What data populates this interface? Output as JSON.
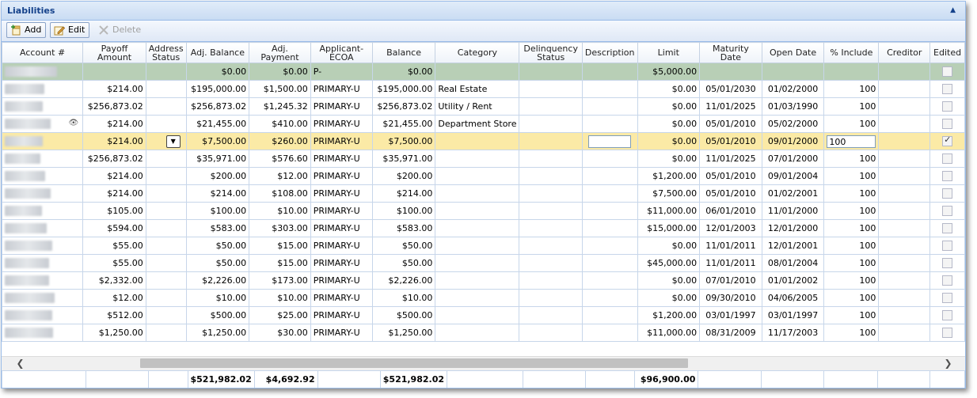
{
  "panel": {
    "title": "Liabilities"
  },
  "toolbar": {
    "add_label": "Add",
    "edit_label": "Edit",
    "delete_label": "Delete"
  },
  "columns": [
    "Account #",
    "Payoff Amount",
    "Address Status",
    "Adj. Balance",
    "Adj. Payment",
    "Applicant-ECOA",
    "Balance",
    "Category",
    "Delinquency Status",
    "Description",
    "Limit",
    "Maturity Date",
    "Open Date",
    "% Include",
    "Creditor",
    "Edited"
  ],
  "summary_row": {
    "adj_balance": "$0.00",
    "adj_payment": "$0.00",
    "applicant": "P-",
    "balance": "$0.00",
    "limit": "$5,000.00"
  },
  "rows": [
    {
      "payoff": "$214.00",
      "adj_balance": "$195,000.00",
      "adj_payment": "$1,500.00",
      "applicant": "PRIMARY-U",
      "balance": "$195,000.00",
      "category": "Real Estate",
      "limit": "$0.00",
      "maturity": "05/01/2030",
      "open": "01/02/2000",
      "include": "100"
    },
    {
      "payoff": "$256,873.02",
      "adj_balance": "$256,873.02",
      "adj_payment": "$1,245.32",
      "applicant": "PRIMARY-U",
      "balance": "$256,873.02",
      "category": "Utility / Rent",
      "limit": "$0.00",
      "maturity": "11/01/2025",
      "open": "01/03/1990",
      "include": "100"
    },
    {
      "payoff": "$214.00",
      "adj_balance": "$21,455.00",
      "adj_payment": "$410.00",
      "applicant": "PRIMARY-U",
      "balance": "$21,455.00",
      "category": "Department Store",
      "limit": "$0.00",
      "maturity": "05/01/2010",
      "open": "05/02/2000",
      "include": "100"
    },
    {
      "payoff": "$214.00",
      "adj_balance": "$7,500.00",
      "adj_payment": "$260.00",
      "applicant": "PRIMARY-U",
      "balance": "$7,500.00",
      "category": "",
      "limit": "$0.00",
      "maturity": "05/01/2010",
      "open": "09/01/2000",
      "include": "100"
    },
    {
      "payoff": "$256,873.02",
      "adj_balance": "$35,971.00",
      "adj_payment": "$576.60",
      "applicant": "PRIMARY-U",
      "balance": "$35,971.00",
      "category": "",
      "limit": "$0.00",
      "maturity": "11/01/2025",
      "open": "07/01/2000",
      "include": "100"
    },
    {
      "payoff": "$214.00",
      "adj_balance": "$200.00",
      "adj_payment": "$12.00",
      "applicant": "PRIMARY-U",
      "balance": "$200.00",
      "category": "",
      "limit": "$1,200.00",
      "maturity": "05/01/2010",
      "open": "09/01/2004",
      "include": "100"
    },
    {
      "payoff": "$214.00",
      "adj_balance": "$214.00",
      "adj_payment": "$108.00",
      "applicant": "PRIMARY-U",
      "balance": "$214.00",
      "category": "",
      "limit": "$7,500.00",
      "maturity": "05/01/2010",
      "open": "01/02/2001",
      "include": "100"
    },
    {
      "payoff": "$105.00",
      "adj_balance": "$100.00",
      "adj_payment": "$10.00",
      "applicant": "PRIMARY-U",
      "balance": "$100.00",
      "category": "",
      "limit": "$11,000.00",
      "maturity": "06/01/2010",
      "open": "11/01/2000",
      "include": "100"
    },
    {
      "payoff": "$594.00",
      "adj_balance": "$583.00",
      "adj_payment": "$303.00",
      "applicant": "PRIMARY-U",
      "balance": "$583.00",
      "category": "",
      "limit": "$15,000.00",
      "maturity": "12/01/2003",
      "open": "12/01/2000",
      "include": "100"
    },
    {
      "payoff": "$55.00",
      "adj_balance": "$50.00",
      "adj_payment": "$15.00",
      "applicant": "PRIMARY-U",
      "balance": "$50.00",
      "category": "",
      "limit": "$0.00",
      "maturity": "11/01/2011",
      "open": "12/01/2001",
      "include": "100"
    },
    {
      "payoff": "$55.00",
      "adj_balance": "$50.00",
      "adj_payment": "$15.00",
      "applicant": "PRIMARY-U",
      "balance": "$50.00",
      "category": "",
      "limit": "$45,000.00",
      "maturity": "11/01/2011",
      "open": "08/01/2004",
      "include": "100"
    },
    {
      "payoff": "$2,332.00",
      "adj_balance": "$2,226.00",
      "adj_payment": "$173.00",
      "applicant": "PRIMARY-U",
      "balance": "$2,226.00",
      "category": "",
      "limit": "$0.00",
      "maturity": "07/01/2010",
      "open": "01/01/2002",
      "include": "100"
    },
    {
      "payoff": "$12.00",
      "adj_balance": "$10.00",
      "adj_payment": "$10.00",
      "applicant": "PRIMARY-U",
      "balance": "$10.00",
      "category": "",
      "limit": "$0.00",
      "maturity": "09/30/2010",
      "open": "04/06/2005",
      "include": "100"
    },
    {
      "payoff": "$512.00",
      "adj_balance": "$500.00",
      "adj_payment": "$25.00",
      "applicant": "PRIMARY-U",
      "balance": "$500.00",
      "category": "",
      "limit": "$1,200.00",
      "maturity": "03/01/1997",
      "open": "03/01/1997",
      "include": "100"
    },
    {
      "payoff": "$1,250.00",
      "adj_balance": "$1,250.00",
      "adj_payment": "$30.00",
      "applicant": "PRIMARY-U",
      "balance": "$1,250.00",
      "category": "",
      "limit": "$11,000.00",
      "maturity": "08/31/2009",
      "open": "11/17/2003",
      "include": "100"
    }
  ],
  "totals": {
    "adj_balance": "$521,982.02",
    "adj_payment": "$4,692.92",
    "balance": "$521,982.02",
    "limit": "$96,900.00"
  },
  "icons": {
    "collapse": "chevron-up-icon",
    "add": "add-record-icon",
    "edit": "edit-pencil-icon",
    "delete": "delete-x-icon"
  },
  "colors": {
    "header_text": "#15428b",
    "selected_row": "#fbeaa6",
    "summary_row": "#b8cfb6"
  }
}
